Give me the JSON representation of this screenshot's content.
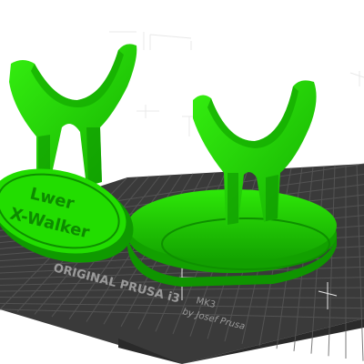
{
  "scene": {
    "background": "#ffffff",
    "bed": {
      "brand_text": "ORIGINAL PRUSA i3",
      "model_text": "MK3",
      "author_text": "by Josef Prusa",
      "plate_color": "#3a3a3a",
      "grid_color": "#5a5a5a",
      "edge_color": "#2a2a2a"
    },
    "model": {
      "color": "#22dd00",
      "shade_color": "#12a800",
      "dark_color": "#0a7f00",
      "plaque_lines": [
        "Lwer",
        "X-Walker"
      ]
    }
  }
}
